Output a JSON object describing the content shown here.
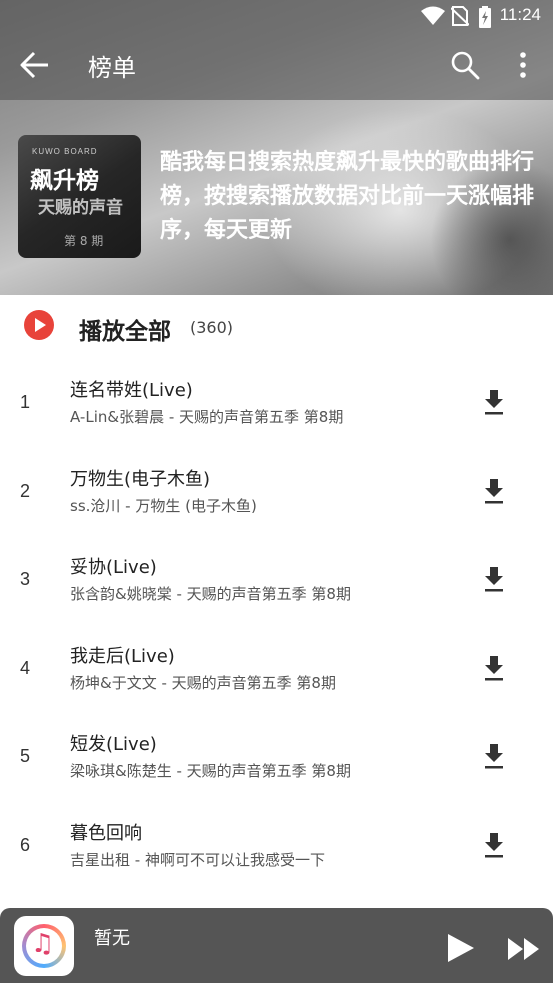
{
  "status_bar": {
    "time": "11:24",
    "icons": [
      "wifi-icon",
      "no-sim-icon",
      "battery-charging-icon"
    ]
  },
  "app_bar": {
    "title": "榜单",
    "icons": [
      "back-arrow-icon",
      "search-icon",
      "more-vert-icon"
    ]
  },
  "playlist": {
    "cover": {
      "brand": "KUWO BOARD",
      "title": "飙升榜",
      "subtitle": "天赐的声音",
      "episode": "第 8 期"
    },
    "description": "酷我每日搜索热度飙升最快的歌曲排行榜，按搜索播放数据对比前一天涨幅排序，每天更新"
  },
  "play_all": {
    "label": "播放全部",
    "count": "(360)",
    "accent_color": "#e8433a"
  },
  "songs": [
    {
      "rank": "1",
      "title": "连名带姓(Live)",
      "subtitle": "A-Lin&张碧晨 - 天赐的声音第五季 第8期"
    },
    {
      "rank": "2",
      "title": "万物生(电子木鱼)",
      "subtitle": "ss.沧川 - 万物生 (电子木鱼)"
    },
    {
      "rank": "3",
      "title": "妥协(Live)",
      "subtitle": "张含韵&姚晓棠 - 天赐的声音第五季 第8期"
    },
    {
      "rank": "4",
      "title": "我走后(Live)",
      "subtitle": "杨坤&于文文 - 天赐的声音第五季 第8期"
    },
    {
      "rank": "5",
      "title": "短发(Live)",
      "subtitle": "梁咏琪&陈楚生 - 天赐的声音第五季 第8期"
    },
    {
      "rank": "6",
      "title": "暮色回响",
      "subtitle": "吉星出租 - 神啊可不可以让我感受一下"
    }
  ],
  "mini_player": {
    "title": "暂无",
    "icons": [
      "music-app-icon",
      "play-icon",
      "fast-forward-icon"
    ]
  }
}
